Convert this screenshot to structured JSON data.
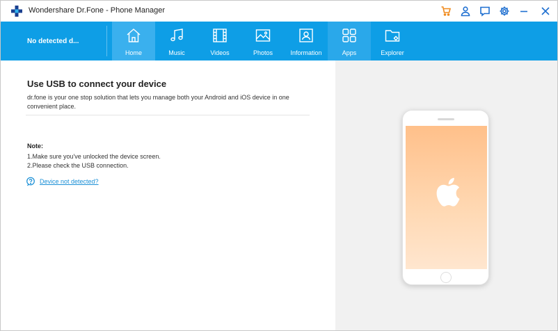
{
  "window": {
    "title": "Wondershare Dr.Fone - Phone Manager"
  },
  "titlebar": {
    "icons": [
      "cart-icon",
      "user-icon",
      "feedback-icon",
      "settings-icon",
      "minimize-icon",
      "close-icon"
    ],
    "accent": "#f08a1c",
    "icon_color": "#1e8fd8"
  },
  "navbar": {
    "background": "#0e9ee6",
    "device_label": "No detected d...",
    "tabs": [
      {
        "label": "Home",
        "icon": "home-icon",
        "active": true
      },
      {
        "label": "Music",
        "icon": "music-icon"
      },
      {
        "label": "Videos",
        "icon": "video-icon"
      },
      {
        "label": "Photos",
        "icon": "photo-icon"
      },
      {
        "label": "Information",
        "icon": "contact-icon"
      },
      {
        "label": "Apps",
        "icon": "apps-icon"
      },
      {
        "label": "Explorer",
        "icon": "folder-icon"
      }
    ]
  },
  "main": {
    "heading": "Use USB to connect your device",
    "description": "dr.fone is your one stop solution that lets you manage both your Android and iOS device in one convenient place.",
    "note_title": "Note:",
    "note_lines": [
      "1.Make sure you've unlocked the device screen.",
      "2.Please check the USB connection."
    ],
    "help_link": "Device not detected?"
  },
  "illustration": {
    "device": "phone",
    "logo": "apple-icon"
  }
}
